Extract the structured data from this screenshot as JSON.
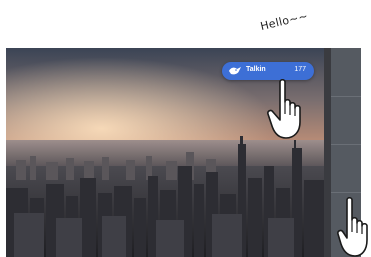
{
  "annotation": {
    "text": "Hello~~"
  },
  "notification": {
    "label": "Talkin",
    "count": "177",
    "icon": "bird-icon",
    "color": "#3d6fd6"
  },
  "background": {
    "subject": "city-skyline-sunset"
  },
  "cursors": [
    {
      "icon": "hand-pointer-icon"
    },
    {
      "icon": "hand-pointer-icon"
    }
  ]
}
